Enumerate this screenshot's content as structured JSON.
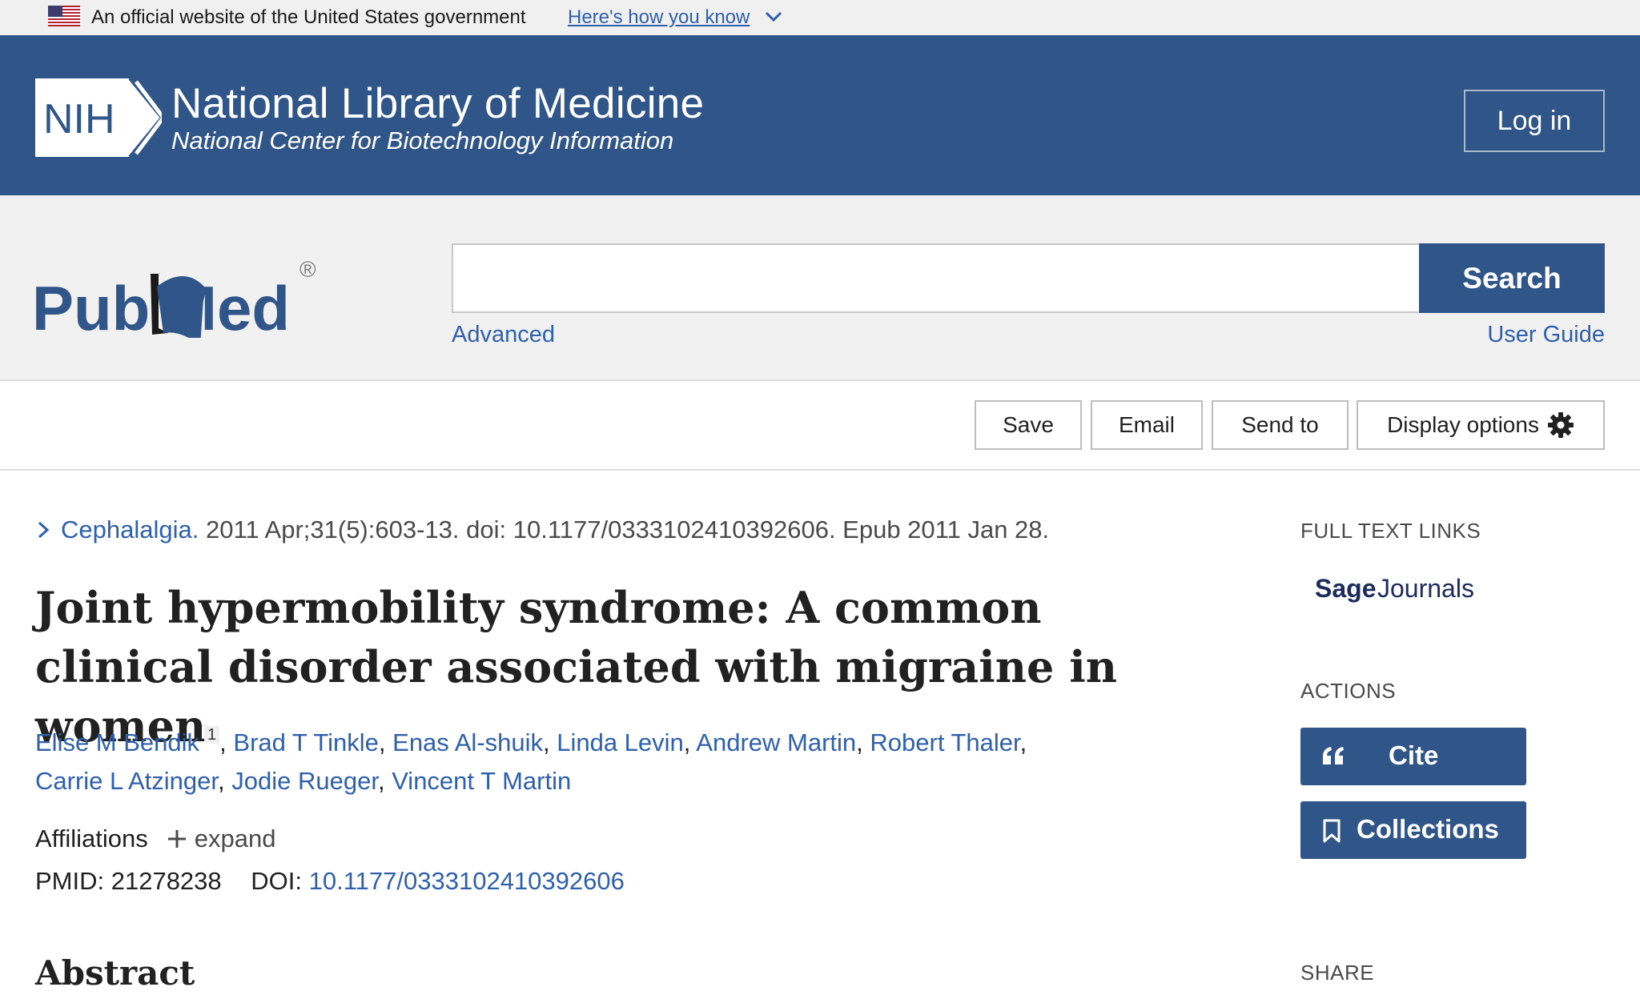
{
  "gov_banner": {
    "text": "An official website of the United States government",
    "link": "Here's how you know"
  },
  "nih_header": {
    "logo_text": "NIH",
    "title": "National Library of Medicine",
    "subtitle": "National Center for Biotechnology Information",
    "login_label": "Log in"
  },
  "search": {
    "logo_text_left": "Pub",
    "logo_text_right": "Med",
    "logo_registered": "®",
    "query": "",
    "button_label": "Search",
    "advanced_label": "Advanced",
    "user_guide_label": "User Guide"
  },
  "toolbar": {
    "save_label": "Save",
    "email_label": "Email",
    "send_to_label": "Send to",
    "display_options_label": "Display options"
  },
  "article": {
    "journal_name": "Cephalalgia.",
    "citation": " 2011 Apr;31(5):603-13. doi: 10.1177/0333102410392606. Epub 2011 Jan 28.",
    "title": "Joint hypermobility syndrome: A common clinical disorder associated with migraine in women",
    "authors": [
      {
        "name": "Elise M Bendik",
        "affiliation": "1"
      },
      {
        "name": "Brad T Tinkle"
      },
      {
        "name": "Enas Al-shuik"
      },
      {
        "name": "Linda Levin"
      },
      {
        "name": "Andrew Martin"
      },
      {
        "name": "Robert Thaler"
      },
      {
        "name": "Carrie L Atzinger"
      },
      {
        "name": "Jodie Rueger"
      },
      {
        "name": "Vincent T Martin"
      }
    ],
    "affiliations_label": "Affiliations",
    "expand_label": "expand",
    "pmid_label": "PMID: 21278238",
    "doi_label": "DOI:",
    "doi_value": "10.1177/0333102410392606",
    "abstract_heading": "Abstract"
  },
  "sidebar": {
    "full_text_heading": "FULL TEXT LINKS",
    "sage_logo_text_bold": "Sage",
    "sage_logo_text": "Journals",
    "actions_heading": "ACTIONS",
    "cite_label": "Cite",
    "collections_label": "Collections",
    "share_heading": "SHARE"
  },
  "colors": {
    "nih_blue": "#305588",
    "link_blue": "#2e60ad",
    "banner_gray": "#f0f0f0"
  },
  "icons": [
    "us-flag-icon",
    "chevron-down-icon",
    "nih-logo",
    "pubmed-logo",
    "gear-icon",
    "chevron-right-icon",
    "plus-icon",
    "quote-icon",
    "bookmark-icon"
  ]
}
